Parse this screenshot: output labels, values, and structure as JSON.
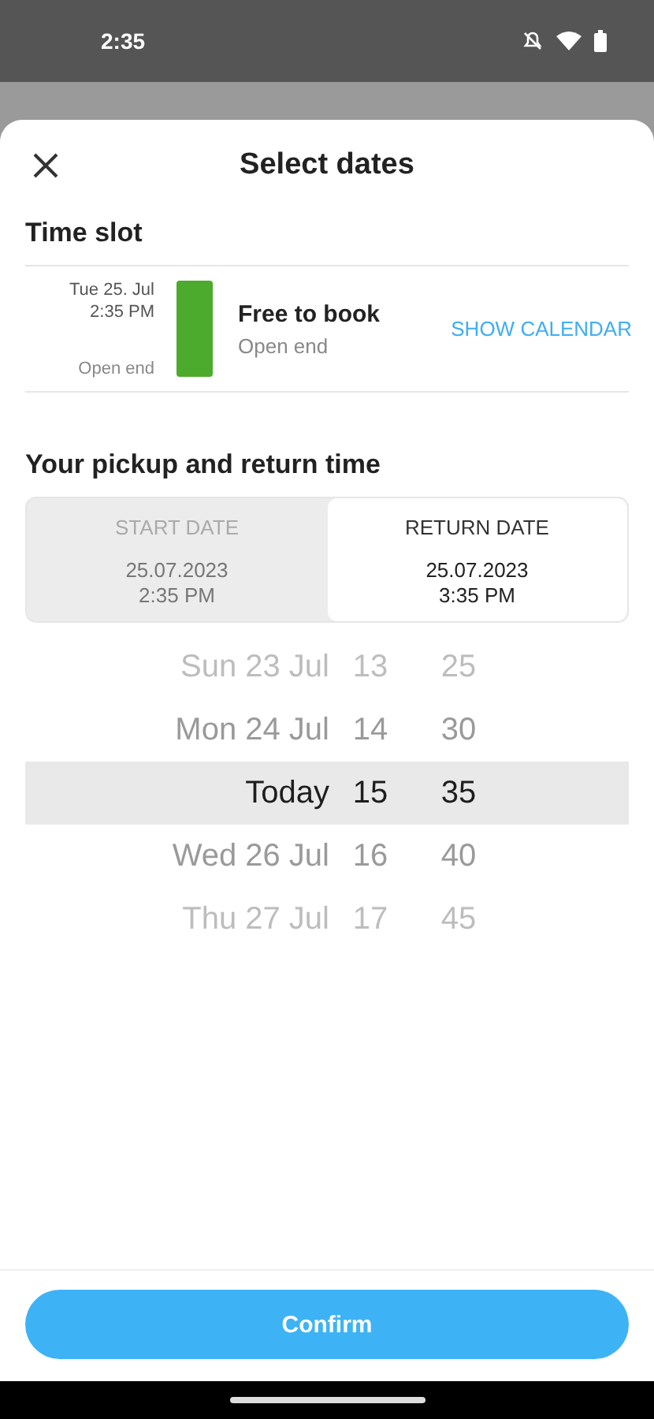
{
  "status_bar": {
    "time": "2:35"
  },
  "sheet": {
    "title": "Select dates"
  },
  "time_slot": {
    "heading": "Time slot",
    "date": "Tue 25. Jul",
    "time": "2:35 PM",
    "end": "Open end",
    "status": "Free to book",
    "status_detail": "Open end",
    "color": "#4caa2c",
    "link": "SHOW CALENDAR"
  },
  "pickup": {
    "heading": "Your pickup and return time",
    "tabs": [
      {
        "label": "START DATE",
        "date": "25.07.2023",
        "time": "2:35 PM",
        "selected": false
      },
      {
        "label": "RETURN DATE",
        "date": "25.07.2023",
        "time": "3:35 PM",
        "selected": true
      }
    ]
  },
  "picker": [
    {
      "day": "Sun 23 Jul",
      "hour": "13",
      "minute": "25",
      "selected": false
    },
    {
      "day": "Mon 24 Jul",
      "hour": "14",
      "minute": "30",
      "selected": false
    },
    {
      "day": "Today",
      "hour": "15",
      "minute": "35",
      "selected": true
    },
    {
      "day": "Wed 26 Jul",
      "hour": "16",
      "minute": "40",
      "selected": false
    },
    {
      "day": "Thu 27 Jul",
      "hour": "17",
      "minute": "45",
      "selected": false
    }
  ],
  "confirm": "Confirm"
}
